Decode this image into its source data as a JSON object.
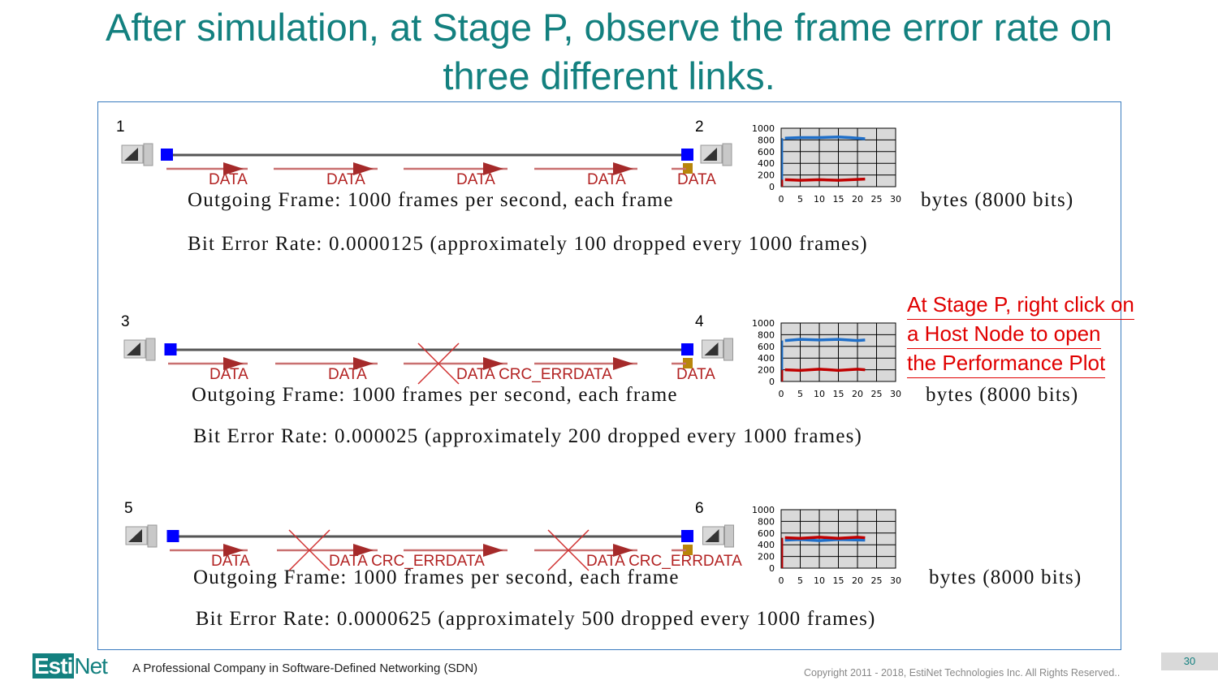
{
  "title_line1": "After simulation, at Stage P, observe the frame error rate on",
  "title_line2": "three different links.",
  "rows": [
    {
      "node_a": "1",
      "node_b": "2",
      "labels": [
        "DATA",
        "DATA",
        "DATA",
        "DATA",
        "DATA"
      ],
      "outgoing": "Outgoing Frame: 1000 frames per second, each frame",
      "bytes": "bytes (8000 bits)",
      "ber": "Bit Error Rate: 0.0000125 (approximately 100 dropped every 1000 frames)",
      "plot": {
        "y_ticks": [
          "1000",
          "800",
          "600",
          "400",
          "200",
          "0"
        ],
        "x_ticks": [
          "0",
          "5",
          "10",
          "15",
          "20",
          "25",
          "30"
        ],
        "blue": [
          [
            1,
            830
          ],
          [
            5,
            840
          ],
          [
            10,
            840
          ],
          [
            15,
            850
          ],
          [
            18,
            840
          ],
          [
            22,
            820
          ]
        ],
        "red": [
          [
            1,
            120
          ],
          [
            5,
            110
          ],
          [
            10,
            120
          ],
          [
            15,
            110
          ],
          [
            22,
            130
          ]
        ]
      }
    },
    {
      "node_a": "3",
      "node_b": "4",
      "labels": [
        "DATA",
        "DATA",
        "DATA CRC_ERRDATA",
        "DATA"
      ],
      "outgoing": "Outgoing Frame: 1000 frames per second, each frame",
      "bytes": "bytes (8000 bits)",
      "ber": "Bit Error Rate: 0.000025 (approximately 200 dropped every 1000 frames)",
      "plot": {
        "y_ticks": [
          "1000",
          "800",
          "600",
          "400",
          "200",
          "0"
        ],
        "x_ticks": [
          "0",
          "5",
          "10",
          "15",
          "20",
          "25",
          "30"
        ],
        "blue": [
          [
            1,
            700
          ],
          [
            5,
            720
          ],
          [
            10,
            710
          ],
          [
            15,
            720
          ],
          [
            20,
            700
          ],
          [
            22,
            710
          ]
        ],
        "red": [
          [
            1,
            200
          ],
          [
            5,
            190
          ],
          [
            10,
            210
          ],
          [
            15,
            190
          ],
          [
            20,
            210
          ],
          [
            22,
            200
          ]
        ]
      }
    },
    {
      "node_a": "5",
      "node_b": "6",
      "labels": [
        "DATA",
        "DATA CRC_ERRDATA",
        "DATA CRC_ERRDATA"
      ],
      "outgoing": "Outgoing Frame: 1000 frames per second, each frame",
      "bytes": "bytes (8000 bits)",
      "ber": "Bit Error Rate: 0.0000625 (approximately 500 dropped every 1000 frames)",
      "plot": {
        "y_ticks": [
          "1000",
          "800",
          "600",
          "400",
          "200",
          "0"
        ],
        "x_ticks": [
          "0",
          "5",
          "10",
          "15",
          "20",
          "25",
          "30"
        ],
        "blue": [
          [
            1,
            480
          ],
          [
            5,
            490
          ],
          [
            10,
            470
          ],
          [
            15,
            490
          ],
          [
            22,
            480
          ]
        ],
        "red": [
          [
            1,
            520
          ],
          [
            5,
            510
          ],
          [
            10,
            530
          ],
          [
            15,
            510
          ],
          [
            20,
            530
          ],
          [
            22,
            520
          ]
        ]
      }
    }
  ],
  "note": [
    "At Stage P, right click on",
    "a Host Node to open",
    "the Performance Plot"
  ],
  "footer": {
    "logo": "EstiNet",
    "logo_box": "Esti",
    "logo_rest": "Net",
    "tagline": "A Professional Company in Software-Defined Networking (SDN)",
    "copyright": "Copyright  2011 - 2018, EstiNet Technologies Inc. All Rights Reserved..",
    "page": "30"
  },
  "colors": {
    "title": "#13807f",
    "note": "#e00000",
    "link_node": "#0000ff",
    "throughput": "#1f6fc9",
    "drops": "#c00000"
  }
}
